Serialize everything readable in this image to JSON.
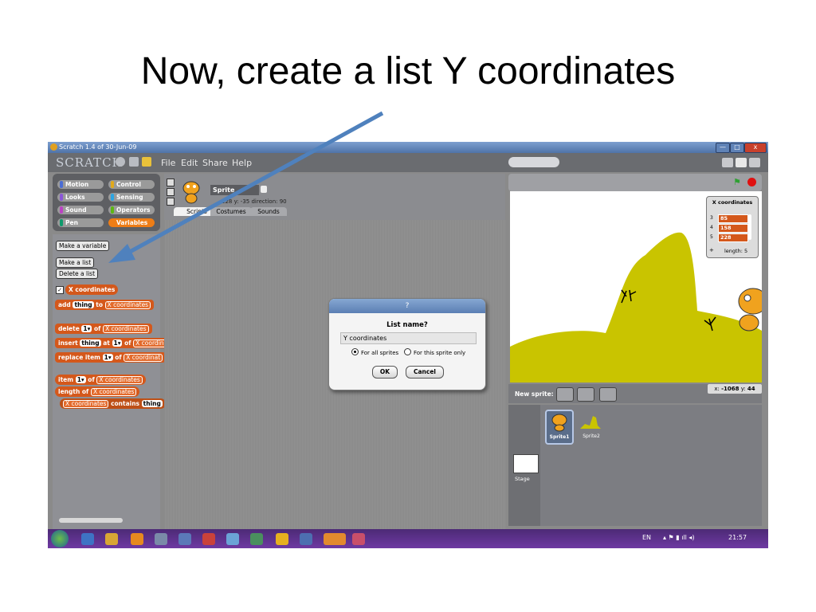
{
  "slide": {
    "title": "Now, create a list Y coordinates"
  },
  "window": {
    "title": "Scratch 1.4 of 30-Jun-09",
    "min": "—",
    "max": "□",
    "close": "x"
  },
  "menubar": {
    "logo": "SCRATCH",
    "items": [
      "File",
      "Edit",
      "Share",
      "Help"
    ]
  },
  "categories": [
    {
      "label": "Motion",
      "color": "#4a6cd4"
    },
    {
      "label": "Control",
      "color": "#e1a91a"
    },
    {
      "label": "Looks",
      "color": "#8a55d7"
    },
    {
      "label": "Sensing",
      "color": "#2ca5e2"
    },
    {
      "label": "Sound",
      "color": "#bb42c3"
    },
    {
      "label": "Operators",
      "color": "#5cb712"
    },
    {
      "label": "Pen",
      "color": "#0e9a6c"
    },
    {
      "label": "Variables",
      "color": "#ee7d16"
    }
  ],
  "palette_buttons": {
    "make_variable": "Make a variable",
    "make_list": "Make a list",
    "delete_list": "Delete a list"
  },
  "list_reporter": "X coordinates",
  "blocks": {
    "add": {
      "w1": "add",
      "thing": "thing",
      "w2": "to",
      "list": "X coordinates"
    },
    "delete": {
      "w1": "delete",
      "idx": "1▾",
      "w2": "of",
      "list": "X coordinates"
    },
    "insert": {
      "w1": "insert",
      "thing": "thing",
      "w2": "at",
      "idx": "1▾",
      "w3": "of",
      "list": "X coordin"
    },
    "replace": {
      "w1": "replace item",
      "idx": "1▾",
      "w2": "of",
      "list": "X coordinat"
    },
    "item": {
      "w1": "item",
      "idx": "1▾",
      "w2": "of",
      "list": "X coordinates"
    },
    "length": {
      "w1": "length of",
      "list": "X coordinates"
    },
    "contains": {
      "list": "X coordinates",
      "w1": "contains",
      "thing": "thing"
    }
  },
  "sprite_header": {
    "name": "Sprite",
    "coords": "228   y: -35   direction: 90"
  },
  "tabs": [
    "Scripts",
    "Costumes",
    "Sounds"
  ],
  "dialog": {
    "title": "?",
    "label": "List name?",
    "value": "Y coordinates",
    "radio_all": "For all sprites",
    "radio_this": "For this sprite only",
    "ok": "OK",
    "cancel": "Cancel"
  },
  "list_monitor": {
    "title": "X coordinates",
    "rows": [
      {
        "n": "3",
        "v": "85"
      },
      {
        "n": "4",
        "v": "158"
      },
      {
        "n": "5",
        "v": "228"
      }
    ],
    "plus": "+",
    "length": "length: 5"
  },
  "new_sprite": {
    "label": "New sprite:"
  },
  "readout": {
    "x_label": "x:",
    "x": "-1068",
    "y_label": "y:",
    "y": "44"
  },
  "sprites": [
    {
      "name": "Sprite1"
    },
    {
      "name": "Sprite2"
    }
  ],
  "stage_label": "Stage",
  "taskbar": {
    "lang": "EN",
    "time": "21:57"
  },
  "colors": {
    "blocks": "#d4581b",
    "hill": "#c9c400",
    "arrow": "#4f81bd"
  }
}
